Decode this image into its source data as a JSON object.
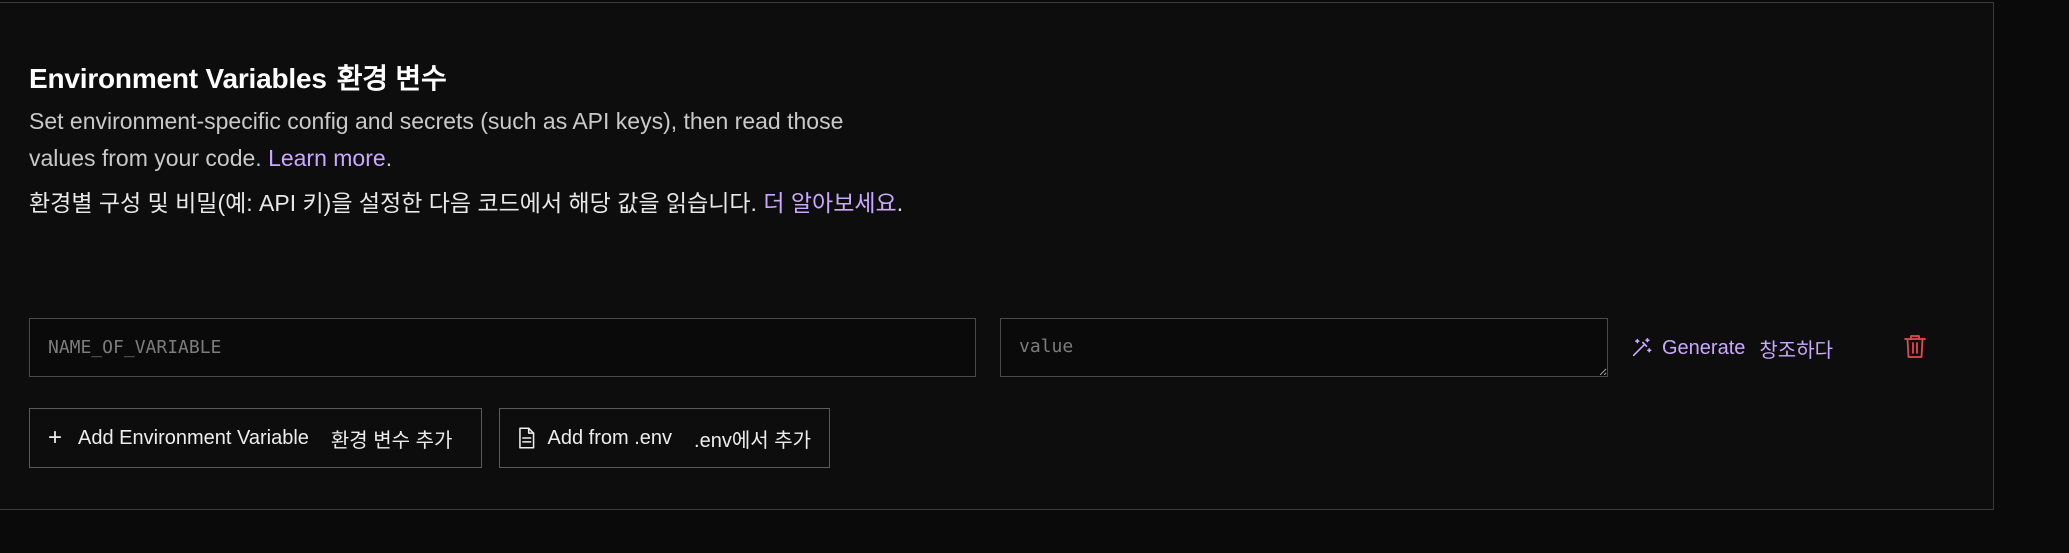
{
  "section": {
    "title": "Environment Variables",
    "title_ko": "환경 변수",
    "description": "Set environment-specific config and secrets (such as API keys), then read those values from your code.",
    "learn_more": "Learn more",
    "description_ko": "환경별 구성 및 비밀(예: API 키)을 설정한 다음 코드에서 해당 값을 읽습니다.",
    "learn_more_ko": "더 알아보세요"
  },
  "variable_row": {
    "name_placeholder": "NAME_OF_VARIABLE",
    "name_value": "",
    "value_placeholder": "value",
    "value_value": "",
    "generate_label": "Generate",
    "generate_label_ko": "창조하다",
    "generate_icon": "magic-wand-icon",
    "delete_icon": "trash-icon"
  },
  "actions": {
    "add_label": "Add Environment Variable",
    "add_label_ko": "환경 변수 추가",
    "add_icon": "plus-icon",
    "import_label": "Add from .env",
    "import_label_ko": ".env에서 추가",
    "import_icon": "file-icon"
  },
  "colors": {
    "background": "#0a0a0a",
    "accent": "#c9a8ff",
    "danger": "#e5484d",
    "border": "#4a4a4a"
  }
}
